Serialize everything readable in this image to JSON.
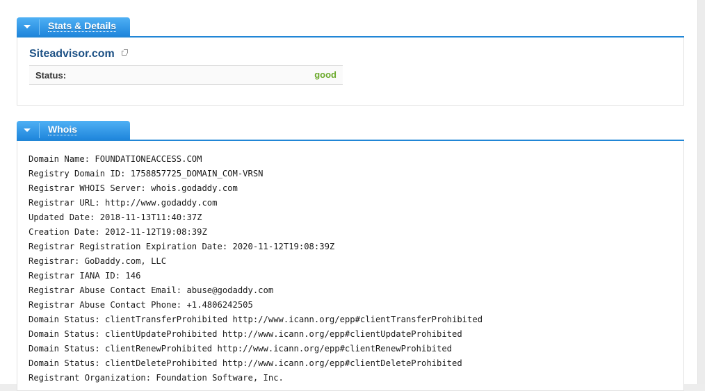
{
  "stats_section": {
    "tab_title": "Stats & Details",
    "site_name": "Siteadvisor.com",
    "status_label": "Status:",
    "status_value": "good",
    "status_color": "#6aa92a"
  },
  "whois_section": {
    "tab_title": "Whois",
    "lines": [
      "Domain Name: FOUNDATIONEACCESS.COM",
      "Registry Domain ID: 1758857725_DOMAIN_COM-VRSN",
      "Registrar WHOIS Server: whois.godaddy.com",
      "Registrar URL: http://www.godaddy.com",
      "Updated Date: 2018-11-13T11:40:37Z",
      "Creation Date: 2012-11-12T19:08:39Z",
      "Registrar Registration Expiration Date: 2020-11-12T19:08:39Z",
      "Registrar: GoDaddy.com, LLC",
      "Registrar IANA ID: 146",
      "Registrar Abuse Contact Email: abuse@godaddy.com",
      "Registrar Abuse Contact Phone: +1.4806242505",
      "Domain Status: clientTransferProhibited http://www.icann.org/epp#clientTransferProhibited",
      "Domain Status: clientUpdateProhibited http://www.icann.org/epp#clientUpdateProhibited",
      "Domain Status: clientRenewProhibited http://www.icann.org/epp#clientRenewProhibited",
      "Domain Status: clientDeleteProhibited http://www.icann.org/epp#clientDeleteProhibited",
      "Registrant Organization: Foundation Software, Inc."
    ]
  },
  "colors": {
    "tab_accent": "#2186d6",
    "link": "#1d5185"
  },
  "icons": {
    "tab_toggle": "caret-down-icon",
    "external_link": "external-link-icon"
  }
}
